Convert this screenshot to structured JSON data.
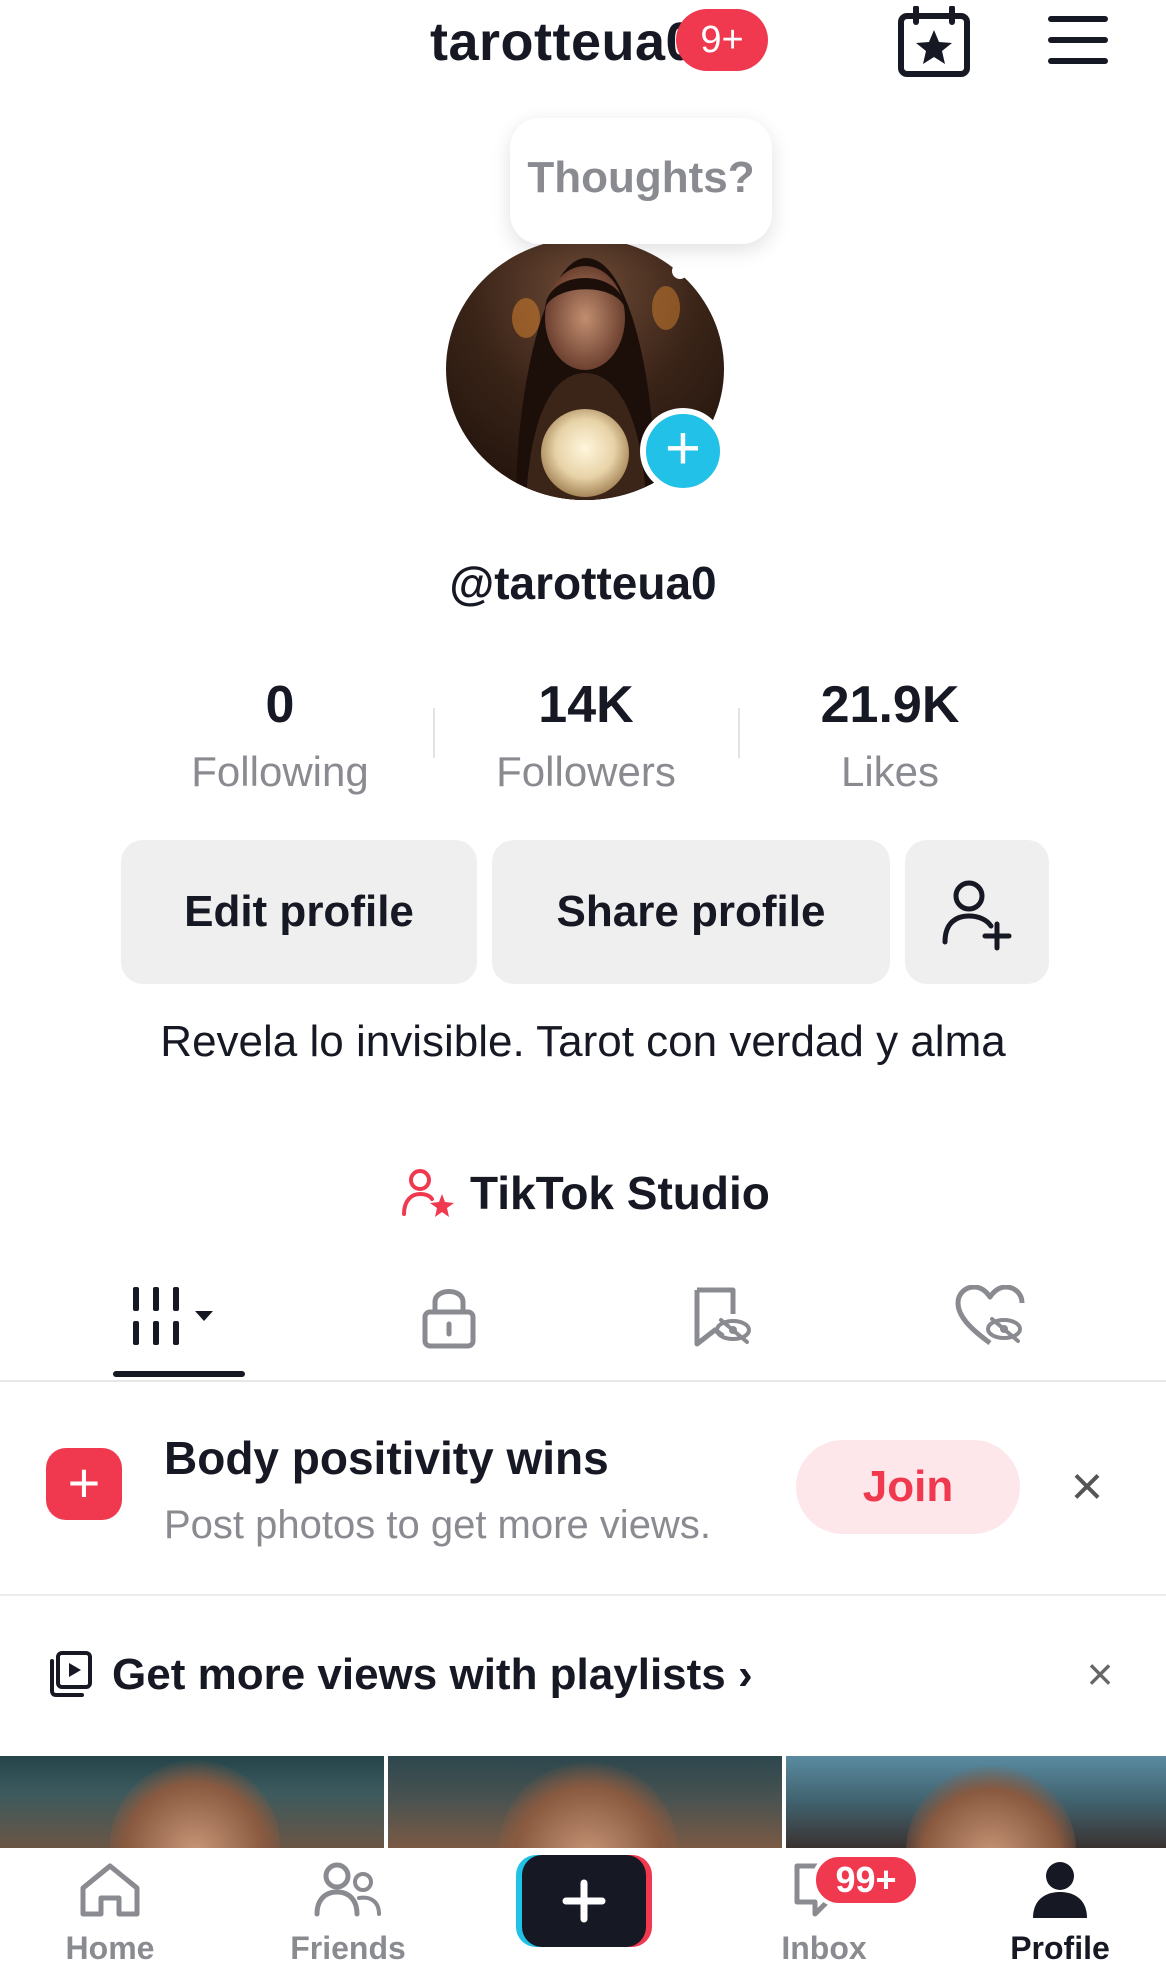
{
  "header": {
    "username": "tarotteua0",
    "badge": "9+",
    "calendar_icon": "calendar-star-icon",
    "menu_icon": "hamburger-menu-icon"
  },
  "thoughts": {
    "placeholder": "Thoughts?"
  },
  "profile": {
    "handle": "@tarotteua0",
    "avatar_icon": "avatar-photo",
    "add_icon": "plus-icon"
  },
  "stats": [
    {
      "value": "0",
      "label": "Following"
    },
    {
      "value": "14K",
      "label": "Followers"
    },
    {
      "value": "21.9K",
      "label": "Likes"
    }
  ],
  "buttons": {
    "edit": "Edit profile",
    "share": "Share profile",
    "add_friend_icon": "add-person-icon"
  },
  "bio": "Revela lo invisible. Tarot con verdad y alma",
  "studio": {
    "label": "TikTok Studio",
    "icon": "person-star-icon"
  },
  "tabs": [
    {
      "icon": "videos-grid-icon",
      "active": true
    },
    {
      "icon": "lock-icon",
      "active": false
    },
    {
      "icon": "bookmark-hidden-icon",
      "active": false
    },
    {
      "icon": "heart-hidden-icon",
      "active": false
    }
  ],
  "promo": {
    "title": "Body positivity wins",
    "subtitle": "Post photos to get more views.",
    "join": "Join",
    "close": "×"
  },
  "playlist": {
    "label": "Get more views with playlists ›",
    "close": "×"
  },
  "nav": {
    "home": "Home",
    "friends": "Friends",
    "inbox": "Inbox",
    "inbox_badge": "99+",
    "profile": "Profile"
  },
  "colors": {
    "accent": "#f0384f",
    "cyan": "#21c1e8",
    "text": "#161823",
    "secondary": "#8a8b91",
    "button_bg": "#efefef"
  }
}
